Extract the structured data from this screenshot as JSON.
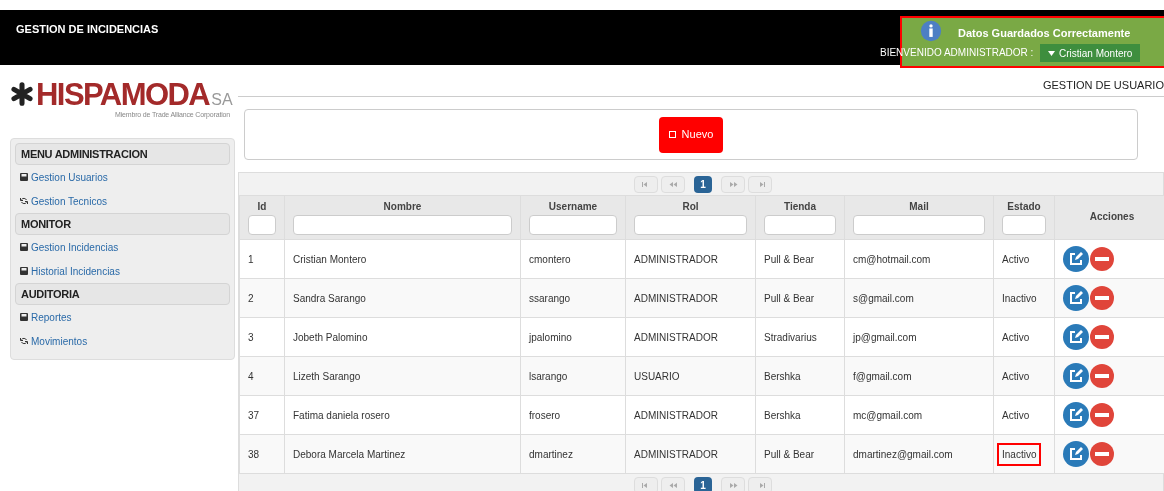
{
  "header": {
    "title": "GESTION DE INCIDENCIAS",
    "welcome": "BIENVENIDO ADMINISTRADOR :",
    "user": "Cristian Montero"
  },
  "toast": {
    "message": "Datos Guardados Correctamente",
    "highlighted": true
  },
  "logo": {
    "name": "HISPAMODA",
    "suffix": "SA",
    "tagline": "Miembro de Trade Alliance Corporation"
  },
  "page_title": "GESTION DE USUARIO",
  "new_button": "Nuevo",
  "sidebar": [
    {
      "title": "MENU ADMINISTRACION",
      "items": [
        {
          "label": "Gestion Usuarios",
          "kind": "disk"
        },
        {
          "label": "Gestion Tecnicos",
          "kind": "refresh"
        }
      ]
    },
    {
      "title": "MONITOR",
      "items": [
        {
          "label": "Gestion Incidencias",
          "kind": "disk"
        },
        {
          "label": "Historial Incidencias",
          "kind": "disk"
        }
      ]
    },
    {
      "title": "AUDITORIA",
      "items": [
        {
          "label": "Reportes",
          "kind": "disk"
        },
        {
          "label": "Movimientos",
          "kind": "refresh"
        }
      ]
    }
  ],
  "pager_top": {
    "pages": [
      {
        "label": "1",
        "selected": true
      }
    ]
  },
  "pager_bottom": {
    "pages": [
      {
        "label": "1",
        "selected": true
      }
    ]
  },
  "table": {
    "columns": [
      {
        "label": "Id",
        "filter": true
      },
      {
        "label": "Nombre",
        "filter": true
      },
      {
        "label": "Username",
        "filter": true
      },
      {
        "label": "Rol",
        "filter": true
      },
      {
        "label": "Tienda",
        "filter": true
      },
      {
        "label": "Mail",
        "filter": true
      },
      {
        "label": "Estado",
        "filter": true
      },
      {
        "label": "Acciones",
        "filter": false
      }
    ],
    "rows": [
      {
        "id": "1",
        "nombre": "Cristian Montero",
        "username": "cmontero",
        "rol": "ADMINISTRADOR",
        "tienda": "Pull & Bear",
        "mail": "cm@hotmail.com",
        "estado": "Activo",
        "highlighted": false
      },
      {
        "id": "2",
        "nombre": "Sandra Sarango",
        "username": "ssarango",
        "rol": "ADMINISTRADOR",
        "tienda": "Pull & Bear",
        "mail": "s@gmail.com",
        "estado": "Inactivo",
        "highlighted": false
      },
      {
        "id": "3",
        "nombre": "Jobeth Palomino",
        "username": "jpalomino",
        "rol": "ADMINISTRADOR",
        "tienda": "Stradivarius",
        "mail": "jp@gmail.com",
        "estado": "Activo",
        "highlighted": false
      },
      {
        "id": "4",
        "nombre": "Lizeth Sarango",
        "username": "lsarango",
        "rol": "USUARIO",
        "tienda": "Bershka",
        "mail": "f@gmail.com",
        "estado": "Activo",
        "highlighted": false
      },
      {
        "id": "37",
        "nombre": "Fatima daniela rosero",
        "username": "frosero",
        "rol": "ADMINISTRADOR",
        "tienda": "Bershka",
        "mail": "mc@gmail.com",
        "estado": "Activo",
        "highlighted": false
      },
      {
        "id": "38",
        "nombre": "Debora Marcela Martinez",
        "username": "dmartinez",
        "rol": "ADMINISTRADOR",
        "tienda": "Pull & Bear",
        "mail": "dmartinez@gmail.com",
        "estado": "Inactivo",
        "highlighted": true
      }
    ]
  }
}
